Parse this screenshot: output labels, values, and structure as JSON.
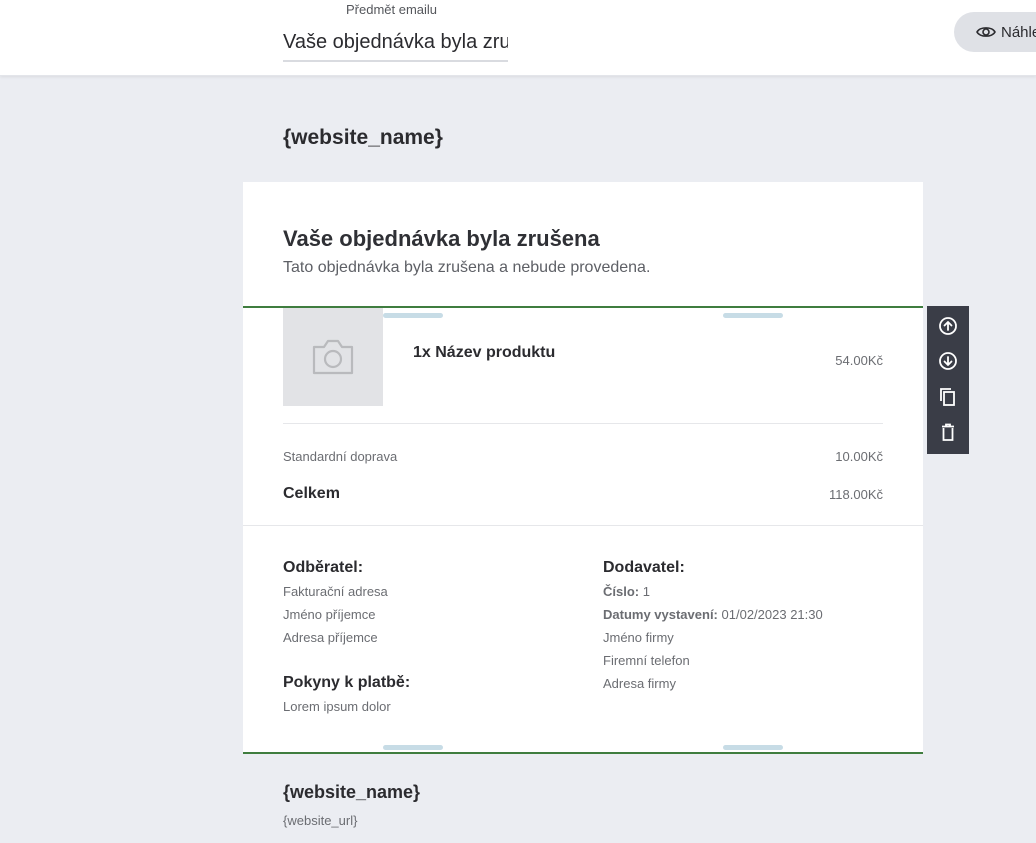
{
  "subject": {
    "label": "Předmět emailu",
    "value": "Vaše objednávka byla zru"
  },
  "toolbar_top": {
    "preview_label": "Náhled"
  },
  "email": {
    "header_site": "{website_name}",
    "title": "Vaše objednávka byla zrušena",
    "subtitle": "Tato objednávka byla zrušena a nebude provedena.",
    "product": {
      "name": "1x Název produktu",
      "price": "54.00Kč",
      "image_icon": "camera-icon"
    },
    "shipping": {
      "label": "Standardní doprava",
      "price": "10.00Kč"
    },
    "total": {
      "label": "Celkem",
      "price": "118.00Kč"
    },
    "customer": {
      "heading": "Odběratel:",
      "lines": [
        "Fakturační adresa",
        "Jméno příjemce",
        "Adresa příjemce"
      ]
    },
    "payment": {
      "heading": "Pokyny k platbě:",
      "text": "Lorem ipsum dolor"
    },
    "supplier": {
      "heading": "Dodavatel:",
      "number_label": "Číslo:",
      "number_value": "1",
      "issued_label": "Datumy vystavení:",
      "issued_value": "01/02/2023 21:30",
      "lines": [
        "Jméno firmy",
        "Firemní telefon",
        "Adresa firmy"
      ]
    },
    "footer": {
      "site": "{website_name}",
      "url": "{website_url}"
    }
  },
  "block_tools": [
    {
      "icon": "move-up-icon"
    },
    {
      "icon": "move-down-icon"
    },
    {
      "icon": "duplicate-icon"
    },
    {
      "icon": "delete-icon"
    }
  ],
  "colors": {
    "canvas": "#ebedf2",
    "selection_border": "#3f7d3f",
    "tool_panel": "#3a3d47",
    "handle": "#c7dce6"
  }
}
